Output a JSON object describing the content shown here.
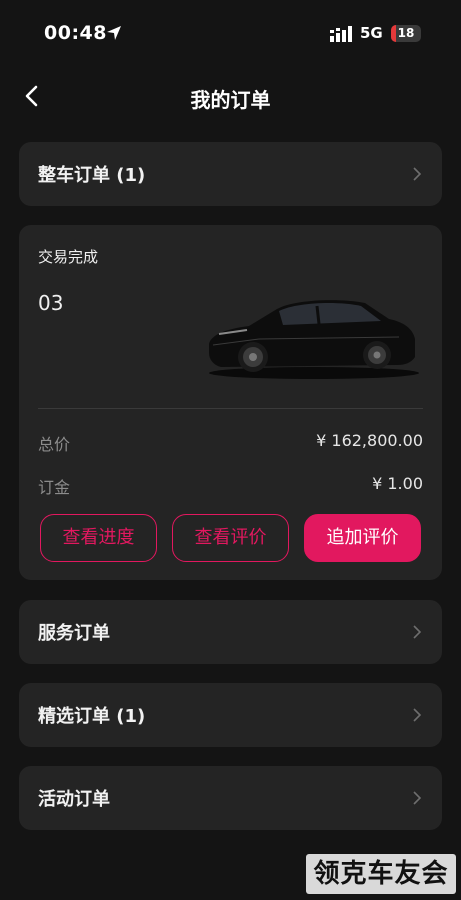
{
  "status_bar": {
    "time": "00:48",
    "network": "5G",
    "battery": "18",
    "battery_level": 0.18,
    "battery_color": "#e5393a"
  },
  "header": {
    "title": "我的订单"
  },
  "rows": {
    "vehicle_orders": "整车订单 (1)",
    "service_orders": "服务订单",
    "selected_orders": "精选订单 (1)",
    "activity_orders": "活动订单"
  },
  "order": {
    "status": "交易完成",
    "model": "03",
    "total_label": "总价",
    "total_value": "¥ 162,800.00",
    "deposit_label": "订金",
    "deposit_value": "¥ 1.00",
    "buttons": {
      "progress": "查看进度",
      "view_review": "查看评价",
      "add_review": "追加评价"
    }
  },
  "watermark": {
    "text": "领克车友会"
  },
  "colors": {
    "accent": "#e2185f",
    "background": "#141414",
    "card": "#242424"
  }
}
